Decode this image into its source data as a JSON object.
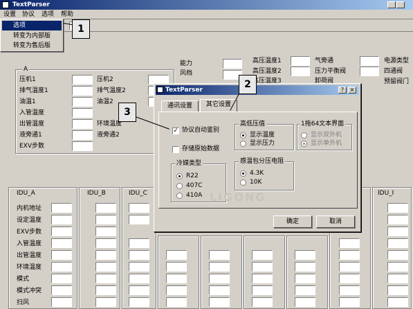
{
  "window": {
    "title": "TextParser"
  },
  "menubar": {
    "items": [
      "设置",
      "协议",
      "选项",
      "帮助"
    ]
  },
  "options_menu": {
    "items": [
      "选项",
      "转变为内部版",
      "转变为售后版"
    ]
  },
  "callouts": [
    "1",
    "2",
    "3"
  ],
  "top_labels": {
    "col1": [
      "能力",
      "风档"
    ],
    "col2": [
      "高压温度1",
      "高压温度2",
      "高压温度3"
    ],
    "col3": [
      "气旁通",
      "压力平衡阀",
      "卸荷阀"
    ],
    "col4": [
      "电源类型",
      "四通阀",
      "预留阀门"
    ]
  },
  "group_a": {
    "title": "A",
    "left_labels": [
      "压机1",
      "排气温度1",
      "油温1",
      "入管温度",
      "出管温度",
      "液旁通1",
      "EXV步数"
    ],
    "right_labels": [
      "压机2",
      "排气温度2",
      "油温2",
      "",
      "环境温度",
      "液旁通2"
    ]
  },
  "idu_columns": [
    "IDU_A",
    "IDU_B",
    "IDU_C",
    "IDU_I"
  ],
  "idu_labels": [
    "内机地址",
    "设定温度",
    "EXV步数",
    "入管温度",
    "出管温度",
    "环境温度",
    "模式",
    "模式冲突",
    "扫风"
  ],
  "watermark": "LIGONG",
  "dialog": {
    "title": "TextParser",
    "help_btn": "?",
    "close_btn": "×",
    "tabs": [
      "通讯设置",
      "其它设置"
    ],
    "auto_detect": {
      "label": "协议自动鉴别",
      "checked": true
    },
    "save_raw": {
      "label": "存储原始数据",
      "checked": false
    },
    "refrigerant": {
      "title": "冷媒类型",
      "options": [
        "R22",
        "407C",
        "410A"
      ],
      "selected": 0
    },
    "pressure": {
      "title": "高低压值",
      "options": [
        "显示温度",
        "显示压力"
      ],
      "selected": 0
    },
    "ui64": {
      "title": "1拖64文本界面",
      "options": [
        "显示双外机",
        "显示单外机"
      ],
      "selected": 1
    },
    "resistor": {
      "title": "感温包分压电阻",
      "options": [
        "4.3K",
        "10K"
      ],
      "selected": 0
    },
    "ok_label": "确定",
    "cancel_label": "取消"
  }
}
